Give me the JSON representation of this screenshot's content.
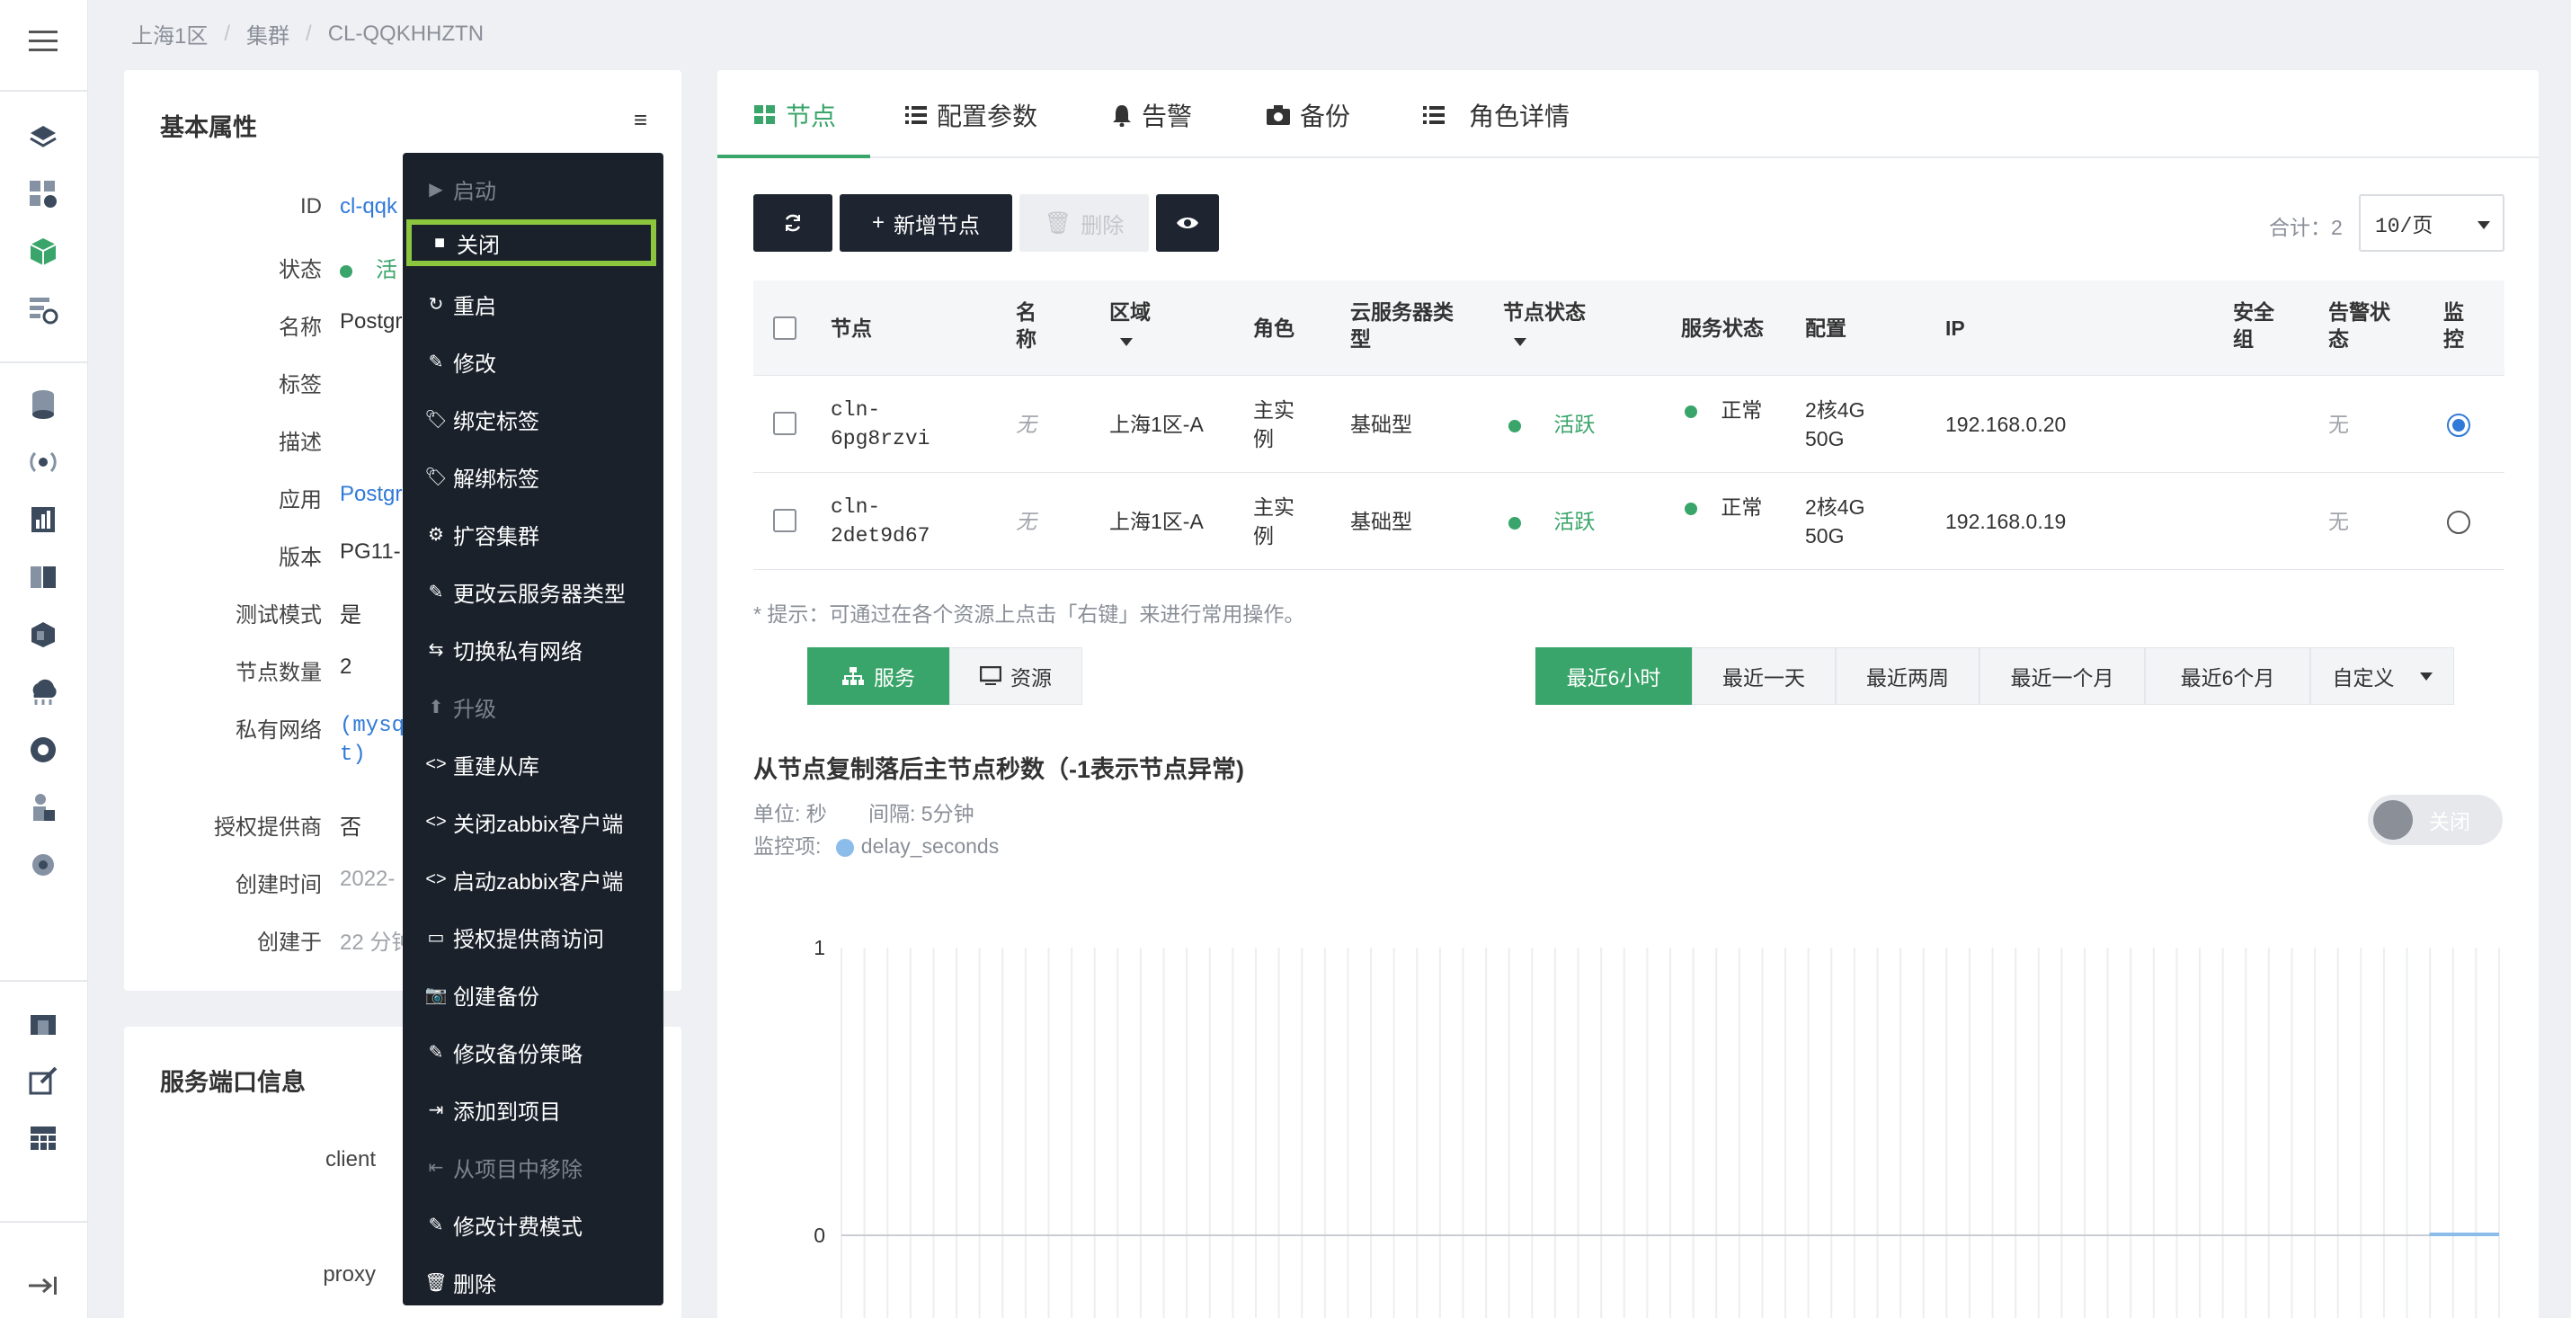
{
  "breadcrumb": [
    "上海1区",
    "集群",
    "CL-QQKHHZTN"
  ],
  "sidebar_icons": [
    "menu-icon",
    "layers-icon",
    "dashboard-settings-icon",
    "cube-icon",
    "deploy-icon",
    "database-icon",
    "signal-icon",
    "bar-chart-icon",
    "book-icon",
    "package-icon",
    "cloud-icon",
    "record-icon",
    "user-lock-icon",
    "gear-user-icon",
    "building-icon",
    "edit-external-icon",
    "table-icon",
    "collapse-icon"
  ],
  "basic": {
    "title": "基本属性",
    "rows": [
      {
        "label": "ID",
        "value": "cl-qqk",
        "style": "link"
      },
      {
        "label": "状态",
        "value": "活",
        "style": "status"
      },
      {
        "label": "名称",
        "value": "Postgr",
        "style": "plain"
      },
      {
        "label": "标签",
        "value": "",
        "style": "plain"
      },
      {
        "label": "描述",
        "value": "",
        "style": "plain"
      },
      {
        "label": "应用",
        "value": "Postgr",
        "style": "link"
      },
      {
        "label": "版本",
        "value": "PG11-",
        "style": "plain"
      },
      {
        "label": "测试模式",
        "value": "是",
        "style": "plain"
      },
      {
        "label": "节点数量",
        "value": "2",
        "style": "plain"
      },
      {
        "label": "私有网络",
        "value": "(mysq",
        "value2": "t)",
        "style": "monolink"
      },
      {
        "label": "授权提供商",
        "value": "否",
        "style": "plain"
      },
      {
        "label": "创建时间",
        "value": "2022-",
        "style": "muted"
      },
      {
        "label": "创建于",
        "value": "22 分钟",
        "style": "muted"
      }
    ]
  },
  "ports": {
    "title": "服务端口信息",
    "rows": [
      "client",
      "proxy"
    ]
  },
  "context_menu": [
    {
      "label": "启动",
      "icon": "▶",
      "disabled": true
    },
    {
      "label": "关闭",
      "icon": "■",
      "selected": true
    },
    {
      "label": "重启",
      "icon": "↻"
    },
    {
      "label": "修改",
      "icon": "✎"
    },
    {
      "label": "绑定标签",
      "icon": "🏷"
    },
    {
      "label": "解绑标签",
      "icon": "🏷"
    },
    {
      "label": "扩容集群",
      "icon": "⚙"
    },
    {
      "label": "更改云服务器类型",
      "icon": "✎"
    },
    {
      "label": "切换私有网络",
      "icon": "⇆"
    },
    {
      "label": "升级",
      "icon": "⬆",
      "disabled": true
    },
    {
      "label": "重建从库",
      "icon": "<>"
    },
    {
      "label": "关闭zabbix客户端",
      "icon": "<>"
    },
    {
      "label": "启动zabbix客户端",
      "icon": "<>"
    },
    {
      "label": "授权提供商访问",
      "icon": "▭"
    },
    {
      "label": "创建备份",
      "icon": "📷"
    },
    {
      "label": "修改备份策略",
      "icon": "✎"
    },
    {
      "label": "添加到项目",
      "icon": "⇥"
    },
    {
      "label": "从项目中移除",
      "icon": "⇤",
      "disabled": true
    },
    {
      "label": "修改计费模式",
      "icon": "✎"
    },
    {
      "label": "删除",
      "icon": "🗑"
    }
  ],
  "tabs": [
    {
      "label": "节点",
      "icon": "grid-icon"
    },
    {
      "label": "配置参数",
      "icon": "list-icon"
    },
    {
      "label": "告警",
      "icon": "bell-icon"
    },
    {
      "label": "备份",
      "icon": "camera-icon"
    },
    {
      "label": "角色详情",
      "icon": "list-icon"
    }
  ],
  "toolbar": {
    "add_label": "新增节点",
    "delete_label": "删除",
    "total_label": "合计：2",
    "page_size": "10/页"
  },
  "table": {
    "headers": {
      "node": "节点",
      "name": "名称",
      "zone": "区域",
      "role": "角色",
      "vm_type": "云服务器类型",
      "node_status": "节点状态",
      "svc_status": "服务状态",
      "config": "配置",
      "ip": "IP",
      "sg": "安全组",
      "alarm": "告警状态",
      "monitor": "监控"
    },
    "rows": [
      {
        "node": "cln-6pg8rzvi",
        "name": "无",
        "zone": "上海1区-A",
        "role": "主实例",
        "vm_type": "基础型",
        "node_status": "活跃",
        "svc_status": "正常",
        "config": "2核4G 50G",
        "ip": "192.168.0.20",
        "sg": "",
        "alarm": "无",
        "monitor": true
      },
      {
        "node": "cln-2det9d67",
        "name": "无",
        "zone": "上海1区-A",
        "role": "主实例",
        "vm_type": "基础型",
        "node_status": "活跃",
        "svc_status": "正常",
        "config": "2核4G 50G",
        "ip": "192.168.0.19",
        "sg": "",
        "alarm": "无",
        "monitor": false
      }
    ]
  },
  "hint": "* 提示：可通过在各个资源上点击「右键」来进行常用操作。",
  "view_switch": {
    "service": "服务",
    "resource": "资源"
  },
  "time_ranges": [
    "最近6小时",
    "最近一天",
    "最近两周",
    "最近一个月",
    "最近6个月",
    "自定义"
  ],
  "chart_header": {
    "title": "从节点复制落后主节点秒数（-1表示节点异常)",
    "unit": "单位: 秒",
    "interval": "间隔: 5分钟",
    "monitor_label": "监控项:",
    "series_name": "delay_seconds",
    "toggle_label": "关闭"
  },
  "chart_data": {
    "type": "line",
    "title": "从节点复制落后主节点秒数（-1表示节点异常)",
    "ylabel": "",
    "xlabel": "",
    "ylim": [
      0,
      1
    ],
    "ytick_labels": [
      "1",
      "0"
    ],
    "series": [
      {
        "name": "delay_seconds",
        "values": [
          0,
          0
        ]
      }
    ],
    "grid": true,
    "colors": {
      "series": "#8bbcea",
      "accent": "#3aa56a"
    }
  }
}
